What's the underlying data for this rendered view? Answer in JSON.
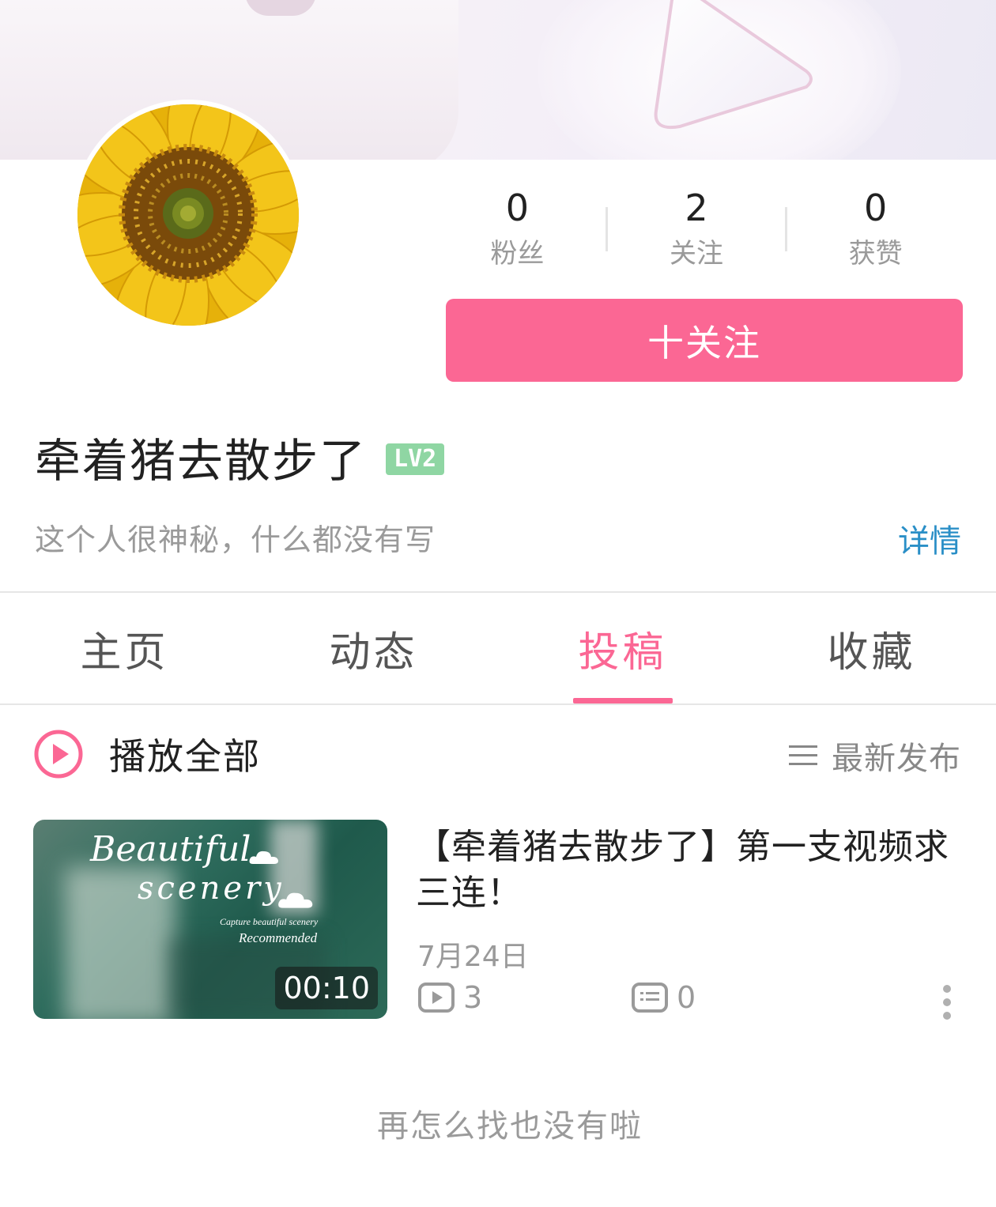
{
  "profile": {
    "name": "牵着猪去散步了",
    "level": "LV2",
    "bio": "这个人很神秘，什么都没有写",
    "detail_link": "详情",
    "follow_button": "十关注"
  },
  "stats": [
    {
      "value": "0",
      "label": "粉丝"
    },
    {
      "value": "2",
      "label": "关注"
    },
    {
      "value": "0",
      "label": "获赞"
    }
  ],
  "tabs": [
    {
      "label": "主页",
      "active": false
    },
    {
      "label": "动态",
      "active": false
    },
    {
      "label": "投稿",
      "active": true
    },
    {
      "label": "收藏",
      "active": false
    }
  ],
  "list_header": {
    "play_all": "播放全部",
    "sort": "最新发布"
  },
  "videos": [
    {
      "title": "【牵着猪去散步了】第一支视频求三连！",
      "date": "7月24日",
      "plays": "3",
      "comments": "0",
      "duration": "00:10",
      "thumbnail_text": {
        "line1": "Beautiful",
        "line2": "scenery",
        "line3": "Capture beautiful scenery",
        "line4": "Recommended"
      }
    }
  ],
  "footer": {
    "empty_text": "再怎么找也没有啦"
  },
  "colors": {
    "accent": "#fb6794",
    "link": "#2a8fc7",
    "level_badge": "#8fd6a3",
    "muted_text": "#9a9a9a"
  }
}
